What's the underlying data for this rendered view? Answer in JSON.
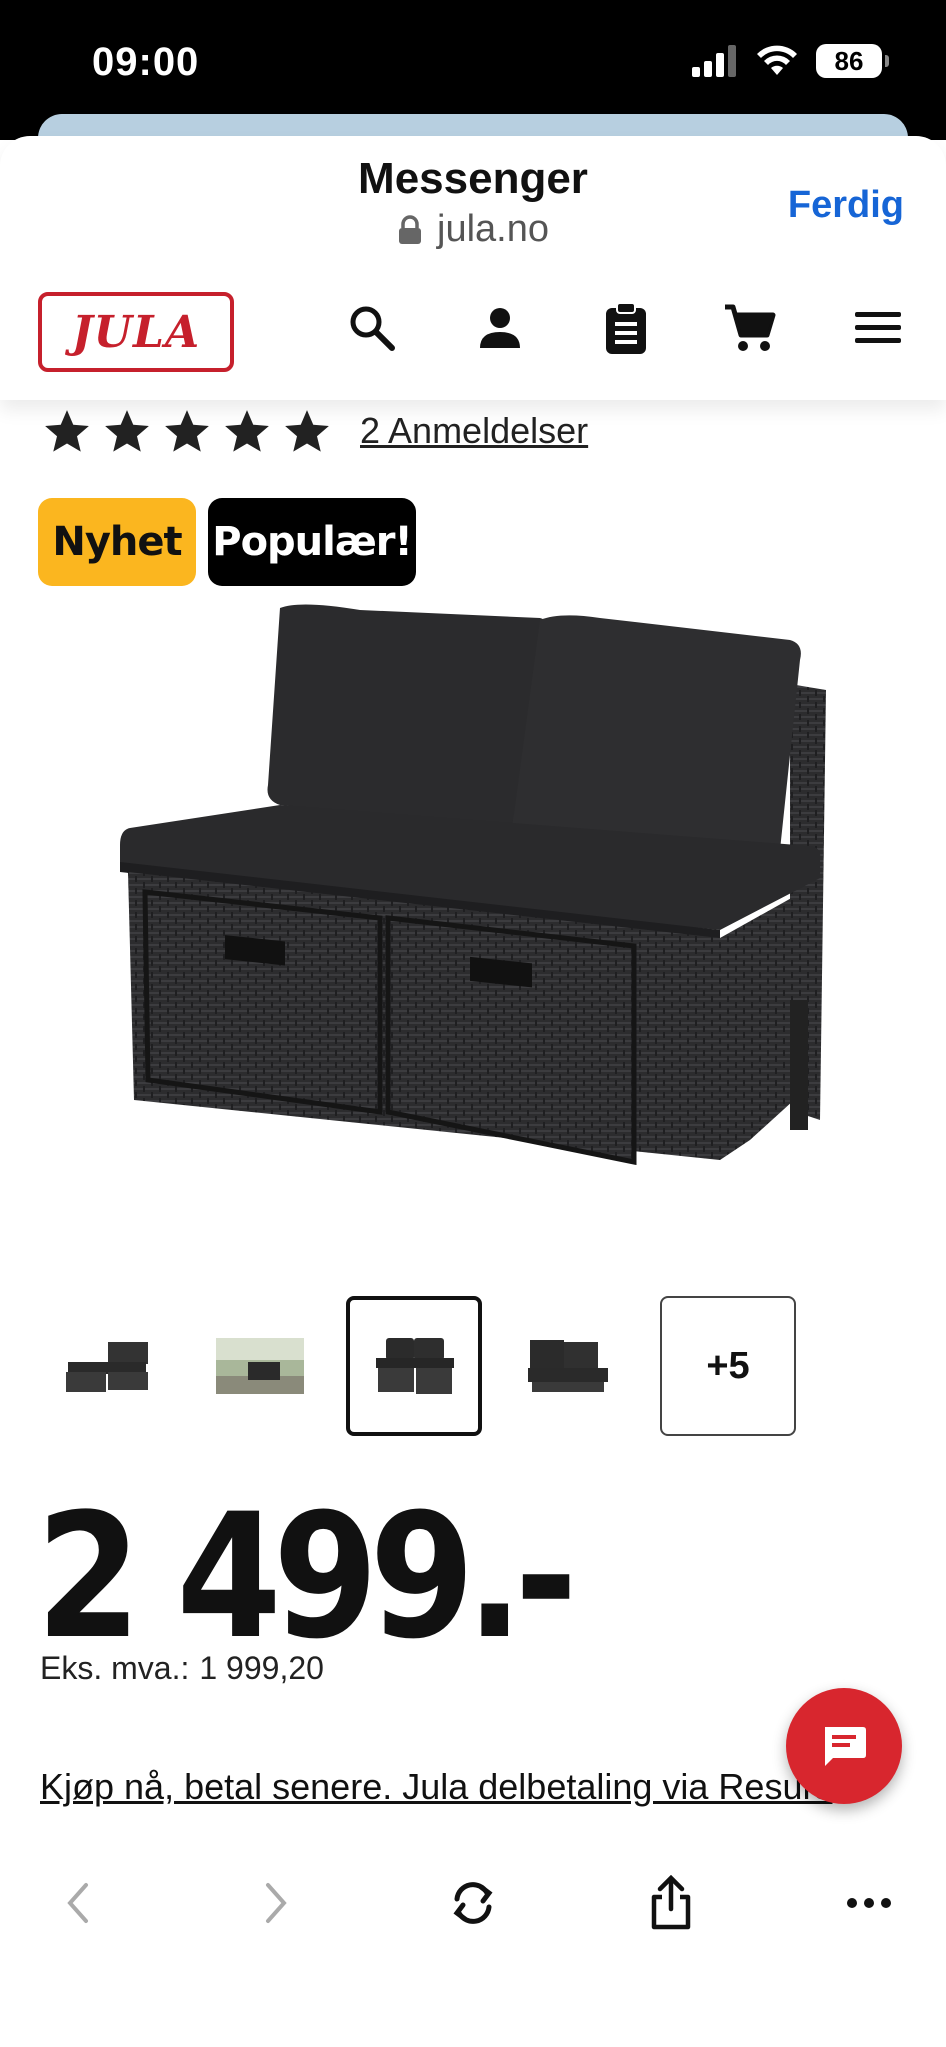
{
  "status_bar": {
    "time": "09:00",
    "battery": "86"
  },
  "browser": {
    "title": "Messenger",
    "url": "jula.no",
    "done_label": "Ferdig"
  },
  "site": {
    "logo_text": "JULA",
    "nav_icons": [
      "search-icon",
      "account-icon",
      "shopping-list-icon",
      "cart-icon",
      "menu-icon"
    ]
  },
  "product": {
    "rating_stars": 5,
    "reviews_label": "2 Anmeldelser",
    "badges": {
      "new": "Nyhet",
      "popular": "Populær!"
    },
    "thumbnails_more": "+5",
    "price": "2 499.-",
    "ex_vat_label": "Eks. mva.:",
    "ex_vat_value": "1 999,20",
    "installment_text": "Kjøp nå, betal senere. Jula delbetaling via Resurs"
  },
  "toolbar": {
    "icons": [
      "back-icon",
      "forward-icon",
      "reload-icon",
      "share-icon",
      "more-icon"
    ]
  },
  "colors": {
    "brand_red": "#c6202c",
    "badge_yellow": "#fbb61f",
    "link_blue": "#1665d6",
    "chat_red": "#d8262e"
  }
}
